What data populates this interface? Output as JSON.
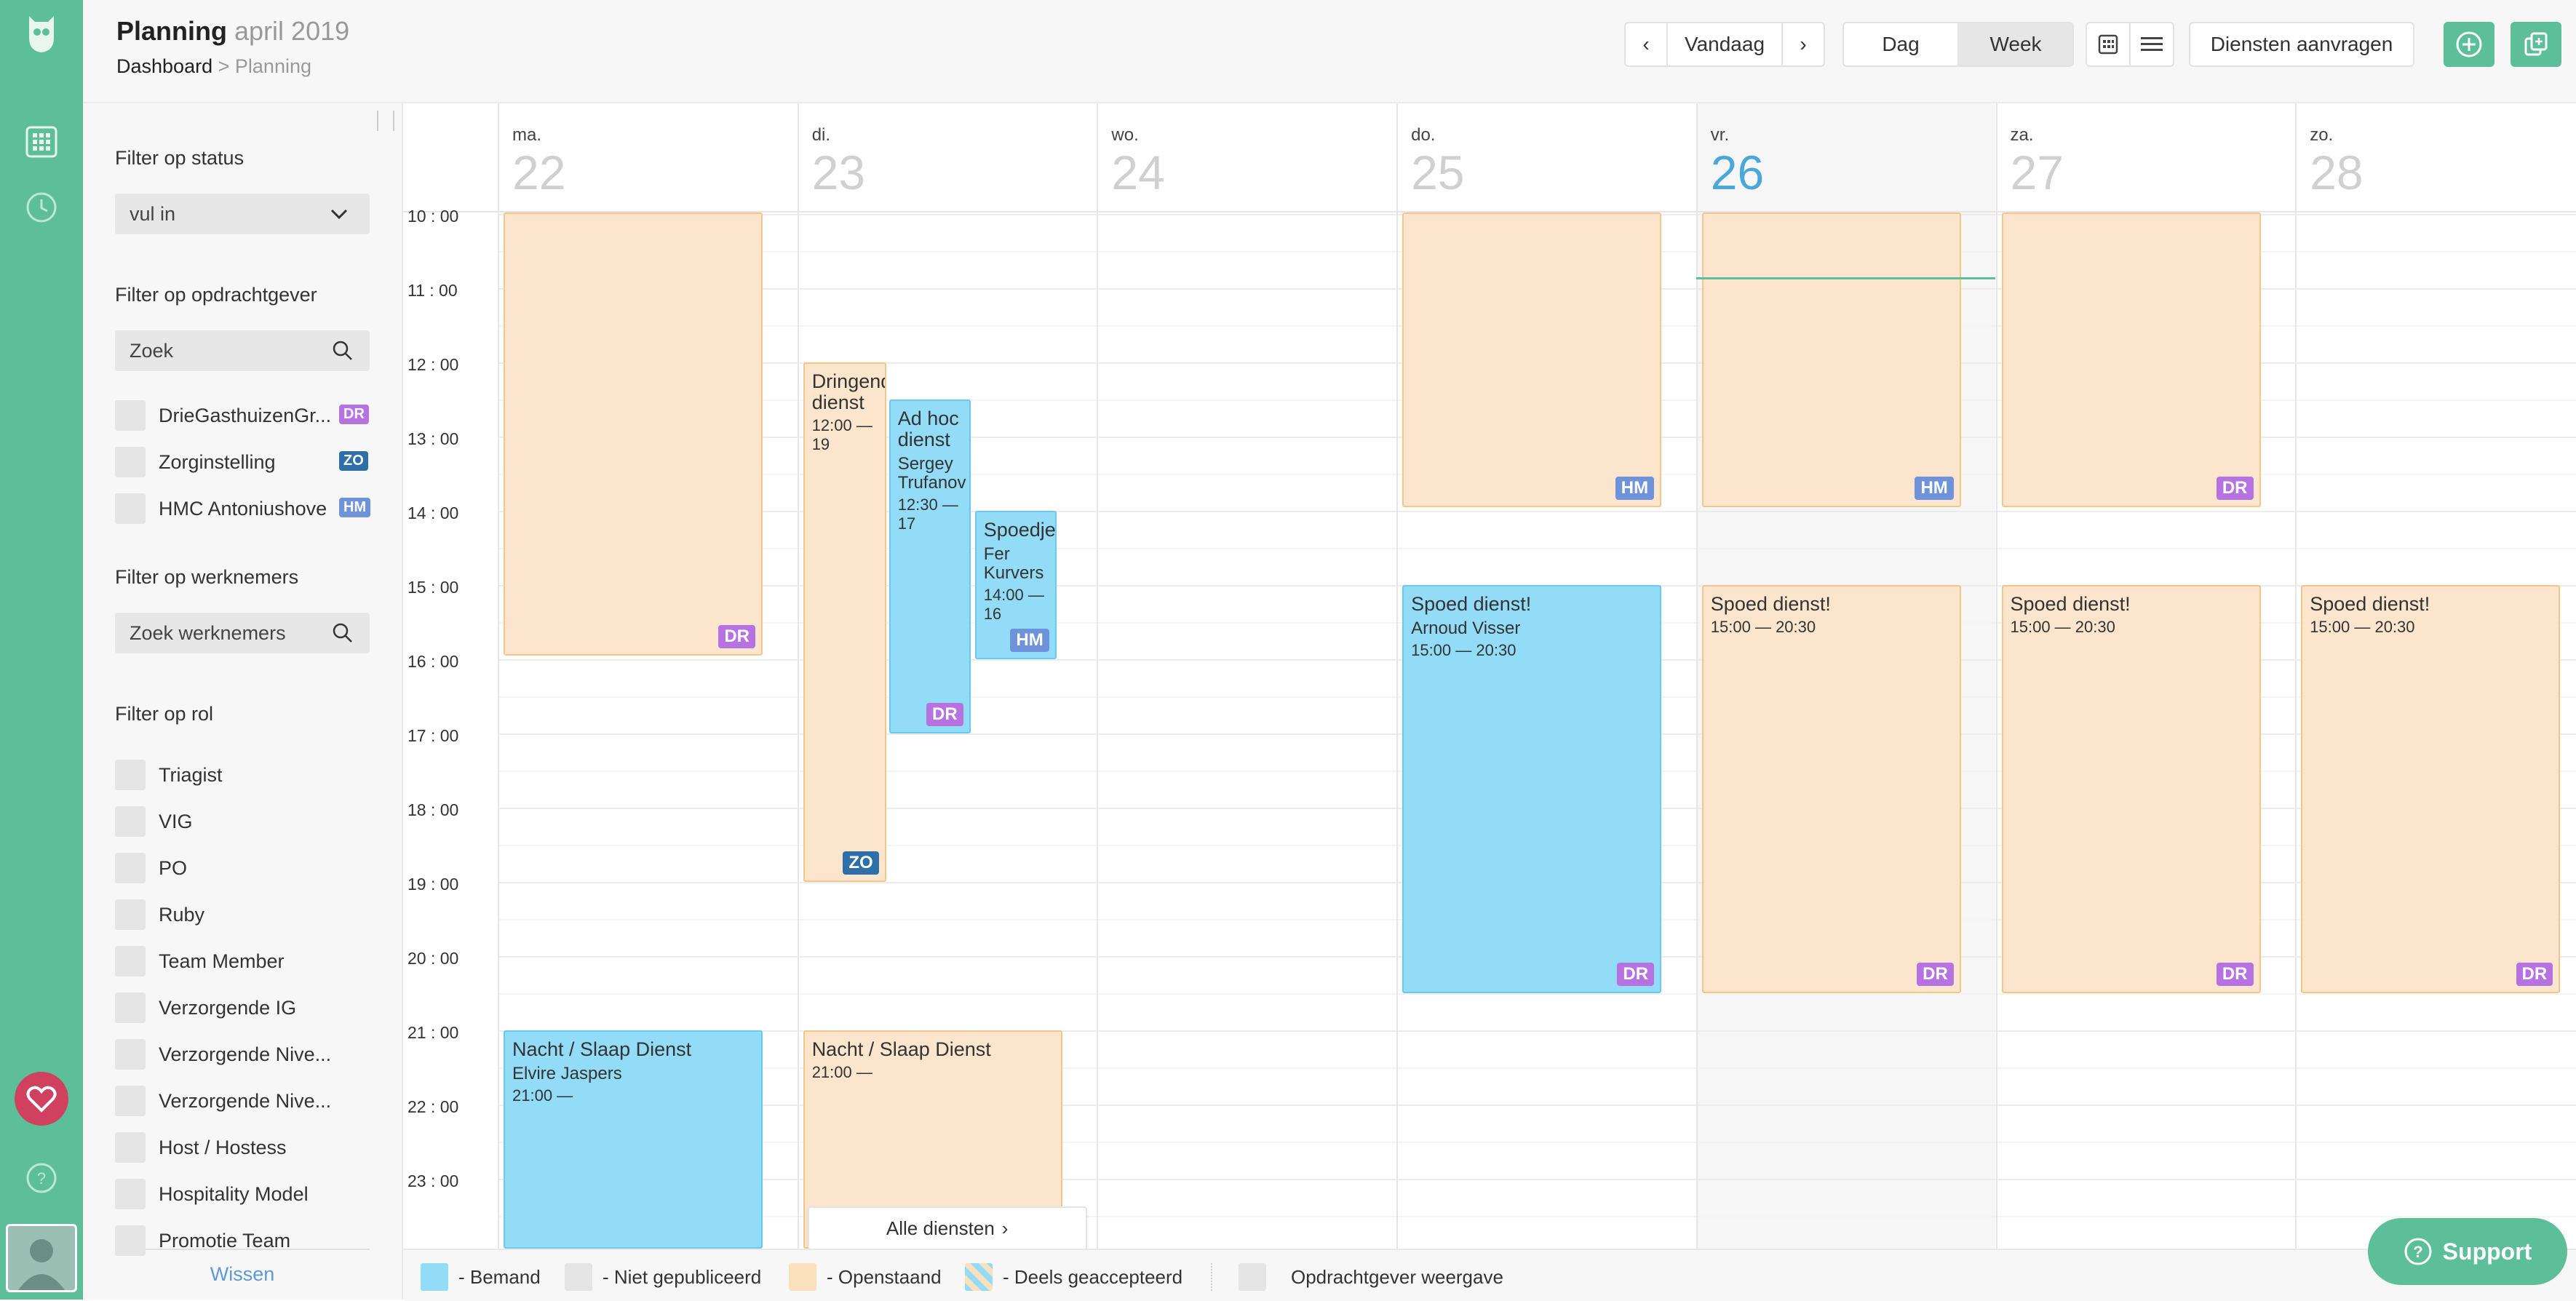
{
  "header": {
    "title": "Planning",
    "subtitle": "april 2019",
    "breadcrumb_root": "Dashboard",
    "breadcrumb_sep": ">",
    "breadcrumb_current": "Planning"
  },
  "toolbar": {
    "today": "Vandaag",
    "day": "Dag",
    "week": "Week",
    "request": "Diensten aanvragen"
  },
  "sidebar": {
    "status_label": "Filter op status",
    "status_value": "vul in",
    "client_label": "Filter op opdrachtgever",
    "client_placeholder": "Zoek",
    "clients": [
      {
        "name": "DrieGasthuizenGr...",
        "badge": "DR",
        "color": "#b572e0"
      },
      {
        "name": "Zorginstelling",
        "badge": "ZO",
        "color": "#2f6fa8"
      },
      {
        "name": "HMC Antoniushove",
        "badge": "HM",
        "color": "#6e93db"
      }
    ],
    "worker_label": "Filter op werknemers",
    "worker_placeholder": "Zoek werknemers",
    "role_label": "Filter op rol",
    "roles": [
      "Triagist",
      "VIG",
      "PO",
      "Ruby",
      "Team Member",
      "Verzorgende IG",
      "Verzorgende Nive...",
      "Verzorgende Nive...",
      "Host / Hostess",
      "Hospitality Model",
      "Promotie Team"
    ],
    "clear": "Wissen"
  },
  "days": [
    {
      "dow": "ma.",
      "num": "22"
    },
    {
      "dow": "di.",
      "num": "23"
    },
    {
      "dow": "wo.",
      "num": "24"
    },
    {
      "dow": "do.",
      "num": "25"
    },
    {
      "dow": "vr.",
      "num": "26"
    },
    {
      "dow": "za.",
      "num": "27"
    },
    {
      "dow": "zo.",
      "num": "28"
    }
  ],
  "hours": [
    "10 : 00",
    "11 : 00",
    "12 : 00",
    "13 : 00",
    "14 : 00",
    "15 : 00",
    "16 : 00",
    "17 : 00",
    "18 : 00",
    "19 : 00",
    "20 : 00",
    "21 : 00",
    "22 : 00",
    "23 : 00"
  ],
  "events": [
    {
      "day": 0,
      "lane": "full",
      "start": 9.8,
      "end": 15.95,
      "type": "open",
      "title": "",
      "person": "",
      "time": "",
      "badge": "DR"
    },
    {
      "day": 1,
      "lane": "a",
      "start": 12,
      "end": 19,
      "type": "open",
      "title": "Dringend dienst",
      "person": "",
      "time": "12:00 — 19",
      "badge": "ZO"
    },
    {
      "day": 1,
      "lane": "b",
      "start": 12.5,
      "end": 17,
      "type": "blue",
      "title": "Ad hoc dienst",
      "person": "Sergey Trufanov",
      "time": "12:30 — 17",
      "badge": "DR"
    },
    {
      "day": 1,
      "lane": "c",
      "start": 14,
      "end": 16,
      "type": "blue",
      "title": "Spoedje",
      "person": "Fer Kurvers",
      "time": "14:00 — 16",
      "badge": "HM"
    },
    {
      "day": 3,
      "lane": "full",
      "start": 9.8,
      "end": 13.95,
      "type": "open",
      "title": "",
      "person": "",
      "time": "",
      "badge": "HM"
    },
    {
      "day": 4,
      "lane": "full",
      "start": 9.8,
      "end": 13.95,
      "type": "open",
      "title": "",
      "person": "",
      "time": "",
      "badge": "HM"
    },
    {
      "day": 5,
      "lane": "full",
      "start": 9.8,
      "end": 13.95,
      "type": "open",
      "title": "",
      "person": "",
      "time": "",
      "badge": "DR"
    },
    {
      "day": 3,
      "lane": "full",
      "start": 15,
      "end": 20.5,
      "type": "blue",
      "title": "Spoed dienst!",
      "person": "Arnoud Visser",
      "time": "15:00 — 20:30",
      "badge": "DR"
    },
    {
      "day": 4,
      "lane": "full",
      "start": 15,
      "end": 20.5,
      "type": "open",
      "title": "Spoed dienst!",
      "person": "",
      "time": "15:00 — 20:30",
      "badge": "DR"
    },
    {
      "day": 5,
      "lane": "full",
      "start": 15,
      "end": 20.5,
      "type": "open",
      "title": "Spoed dienst!",
      "person": "",
      "time": "15:00 — 20:30",
      "badge": "DR"
    },
    {
      "day": 6,
      "lane": "full",
      "start": 15,
      "end": 20.5,
      "type": "open",
      "title": "Spoed dienst!",
      "person": "",
      "time": "15:00 — 20:30",
      "badge": "DR"
    },
    {
      "day": 0,
      "lane": "full",
      "start": 21,
      "end": 23.95,
      "type": "blue",
      "title": "Nacht / Slaap Dienst",
      "person": "Elvire Jaspers",
      "time": "21:00 —",
      "badge": "DR"
    },
    {
      "day": 1,
      "lane": "full",
      "start": 21,
      "end": 24.5,
      "type": "open",
      "title": "Nacht / Slaap Dienst",
      "person": "",
      "time": "21:00 —",
      "badge": ""
    }
  ],
  "badge_colors": {
    "DR": "#b572e0",
    "ZO": "#2f6fa8",
    "HM": "#6e93db"
  },
  "all_shifts": "Alle diensten",
  "legend": [
    {
      "label": "- Bemand",
      "color": "#93dcf7"
    },
    {
      "label": "- Niet gepubliceerd",
      "color": "#e4e4e4"
    },
    {
      "label": "- Openstaand",
      "color": "#fbe0bd"
    },
    {
      "label": "- Deels geaccepteerd",
      "color": "striped"
    },
    {
      "label": "Opdrachtgever weergave",
      "color": "#e4e4e4"
    }
  ],
  "support": "Support",
  "today_color": "#4aa8d8",
  "accent": "#5dbf99"
}
